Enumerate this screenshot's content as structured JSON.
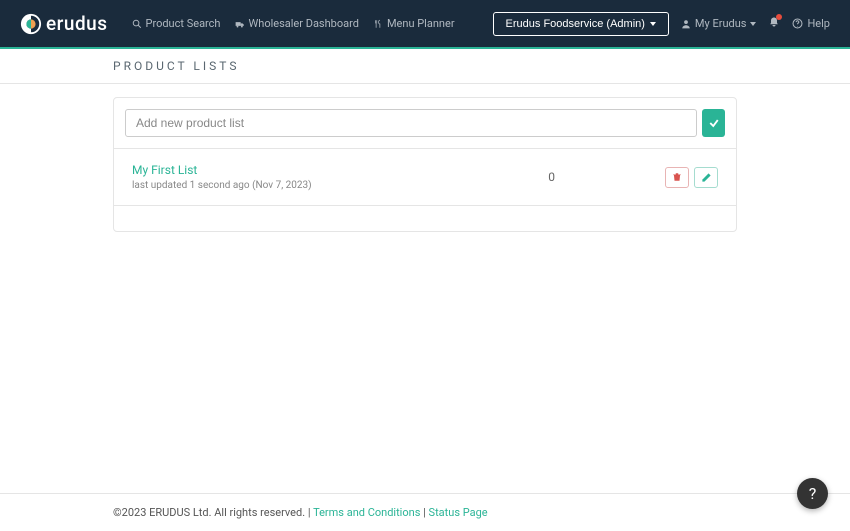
{
  "brand": {
    "name": "erudus"
  },
  "nav": {
    "productSearch": "Product Search",
    "wholesalerDashboard": "Wholesaler Dashboard",
    "menuPlanner": "Menu Planner"
  },
  "navRight": {
    "adminButton": "Erudus Foodservice (Admin)",
    "myErudus": "My Erudus",
    "help": "Help"
  },
  "page": {
    "title": "PRODUCT LISTS"
  },
  "addList": {
    "placeholder": "Add new product list"
  },
  "lists": [
    {
      "name": "My First List",
      "meta": "last updated 1 second ago (Nov 7, 2023)",
      "count": "0"
    }
  ],
  "footer": {
    "copyright": "©2023 ERUDUS Ltd. All rights reserved.",
    "sep": " | ",
    "terms": "Terms and Conditions",
    "status": "Status Page"
  },
  "helpBubble": "?"
}
